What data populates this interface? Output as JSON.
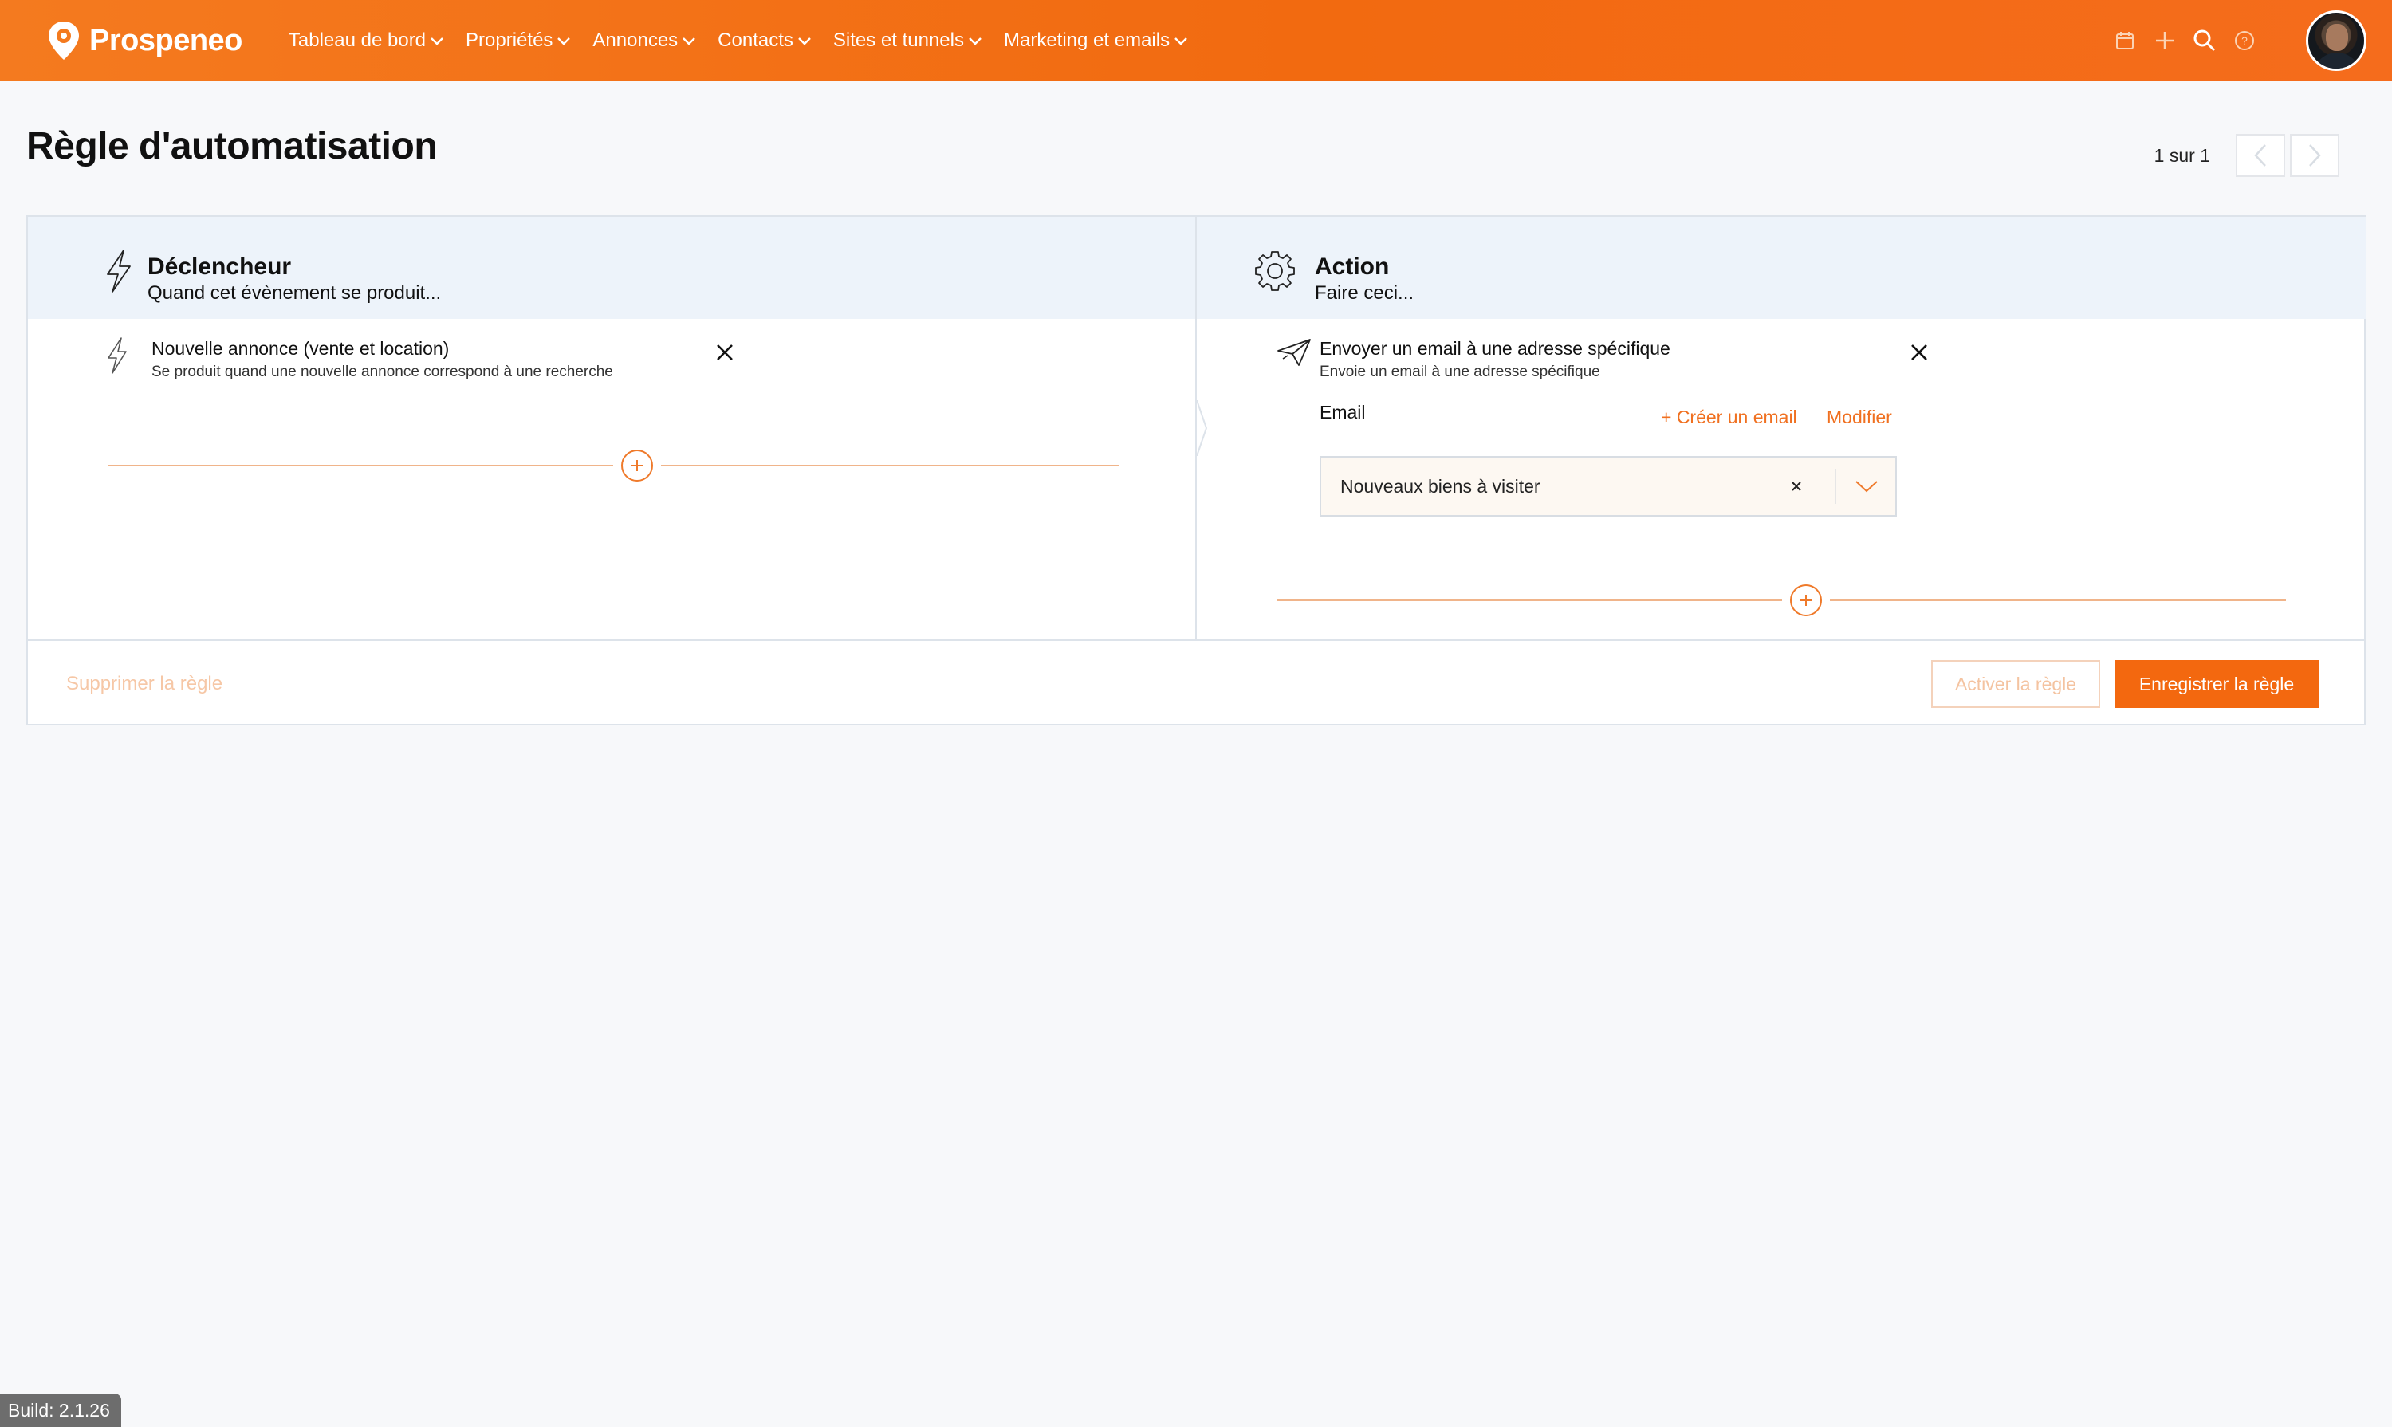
{
  "brand": {
    "name": "Prospeneo"
  },
  "nav": {
    "items": [
      {
        "label": "Tableau de bord"
      },
      {
        "label": "Propriétés"
      },
      {
        "label": "Annonces"
      },
      {
        "label": "Contacts"
      },
      {
        "label": "Sites et tunnels"
      },
      {
        "label": "Marketing et emails"
      }
    ]
  },
  "toolbar": {
    "icons": [
      "calendar-icon",
      "plus-icon",
      "search-icon",
      "help-icon"
    ]
  },
  "page": {
    "title": "Règle d'automatisation"
  },
  "pager": {
    "text": "1 sur 1"
  },
  "trigger": {
    "title": "Déclencheur",
    "subtitle": "Quand cet évènement se produit...",
    "item_title": "Nouvelle annonce (vente et location)",
    "item_subtitle": "Se produit quand une nouvelle annonce correspond à une recherche"
  },
  "action": {
    "title": "Action",
    "subtitle": "Faire ceci...",
    "item_title": "Envoyer un email à une adresse spécifique",
    "item_subtitle": "Envoie un email à une adresse spécifique",
    "email_label": "Email",
    "create_email_label": "+ Créer un email",
    "modify_label": "Modifier",
    "selected_email": "Nouveaux biens à visiter"
  },
  "footer": {
    "delete_label": "Supprimer la règle",
    "activate_label": "Activer la règle",
    "save_label": "Enregistrer la règle"
  },
  "build": {
    "label": "Build: 2.1.26"
  },
  "colors": {
    "brand_orange": "#f3680f",
    "header_blue": "#edf3fa",
    "muted_orange": "#f6c7a6"
  }
}
